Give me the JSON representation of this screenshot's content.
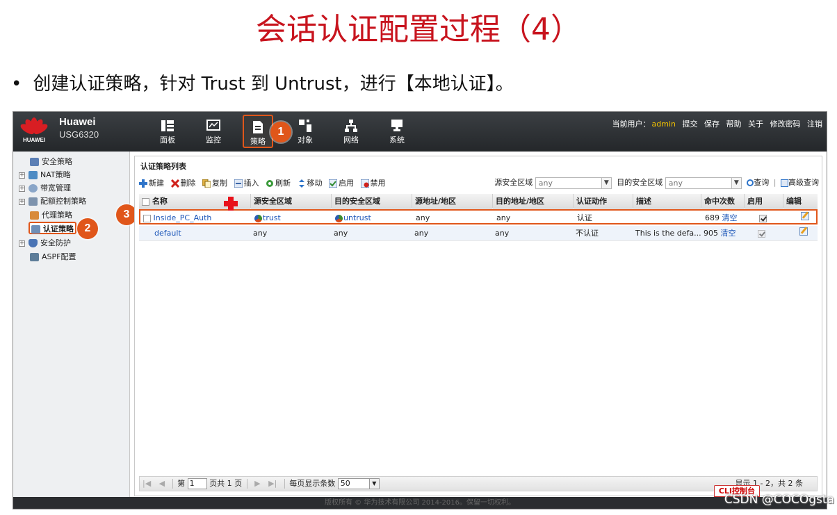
{
  "slide": {
    "title": "会话认证配置过程（4）",
    "bullet": "创建认证策略，针对 Trust 到 Untrust，进行【本地认证】。",
    "watermark": "CSDN @COCOgsta"
  },
  "brand": {
    "name": "Huawei",
    "model": "USG6320",
    "logo_text": "HUAWEI"
  },
  "nav": {
    "items": [
      {
        "label": "面板",
        "icon": "dashboard-icon"
      },
      {
        "label": "监控",
        "icon": "monitor-icon"
      },
      {
        "label": "策略",
        "icon": "policy-icon",
        "active": true
      },
      {
        "label": "对象",
        "icon": "object-icon"
      },
      {
        "label": "网络",
        "icon": "network-icon"
      },
      {
        "label": "系统",
        "icon": "system-icon"
      }
    ]
  },
  "user_bar": {
    "current_user_label": "当前用户：",
    "username": "admin",
    "submit": "提交",
    "save": "保存",
    "help": "帮助",
    "about": "关于",
    "change_password": "修改密码",
    "logout": "注销"
  },
  "sidebar": {
    "items": [
      {
        "label": "安全策略",
        "expandable": false
      },
      {
        "label": "NAT策略",
        "expandable": true
      },
      {
        "label": "带宽管理",
        "expandable": true
      },
      {
        "label": "配额控制策略",
        "expandable": true
      },
      {
        "label": "代理策略",
        "expandable": false
      },
      {
        "label": "认证策略",
        "expandable": false,
        "selected": true
      },
      {
        "label": "安全防护",
        "expandable": true
      },
      {
        "label": "ASPF配置",
        "expandable": false
      }
    ]
  },
  "callouts": {
    "one": "1",
    "two": "2",
    "three": "3"
  },
  "panel": {
    "title": "认证策略列表"
  },
  "toolbar": {
    "new": "新建",
    "delete": "删除",
    "copy": "复制",
    "insert": "插入",
    "refresh": "刷新",
    "move": "移动",
    "enable": "启用",
    "disable": "禁用"
  },
  "filters": {
    "src_zone_label": "源安全区域",
    "src_zone_value": "any",
    "dst_zone_label": "目的安全区域",
    "dst_zone_value": "any",
    "query": "查询",
    "advanced_query": "高级查询"
  },
  "table": {
    "columns": [
      "名称",
      "源安全区域",
      "目的安全区域",
      "源地址/地区",
      "目的地址/地区",
      "认证动作",
      "描述",
      "命中次数",
      "启用",
      "编辑"
    ],
    "rows": [
      {
        "name": "Inside_PC_Auth",
        "src_zone": "trust",
        "dst_zone": "untrust",
        "src_addr": "any",
        "dst_addr": "any",
        "action": "认证",
        "desc": "",
        "hits": "689",
        "clear": "清空",
        "enabled": true
      },
      {
        "name": "default",
        "src_zone": "any",
        "dst_zone": "any",
        "src_addr": "any",
        "dst_addr": "any",
        "action": "不认证",
        "desc": "This is the defa...",
        "hits": "905",
        "clear": "清空",
        "enabled": true
      }
    ]
  },
  "pager": {
    "page_label": "第",
    "page_value": "1",
    "total_pages": "页共 1 页",
    "per_page_label": "每页显示条数",
    "per_page_value": "50",
    "summary": "显示 1 - 2，共 2 条"
  },
  "cli_button": "CLI控制台",
  "footer": "版权所有 © 华为技术有限公司 2014-2016。保留一切权利。"
}
